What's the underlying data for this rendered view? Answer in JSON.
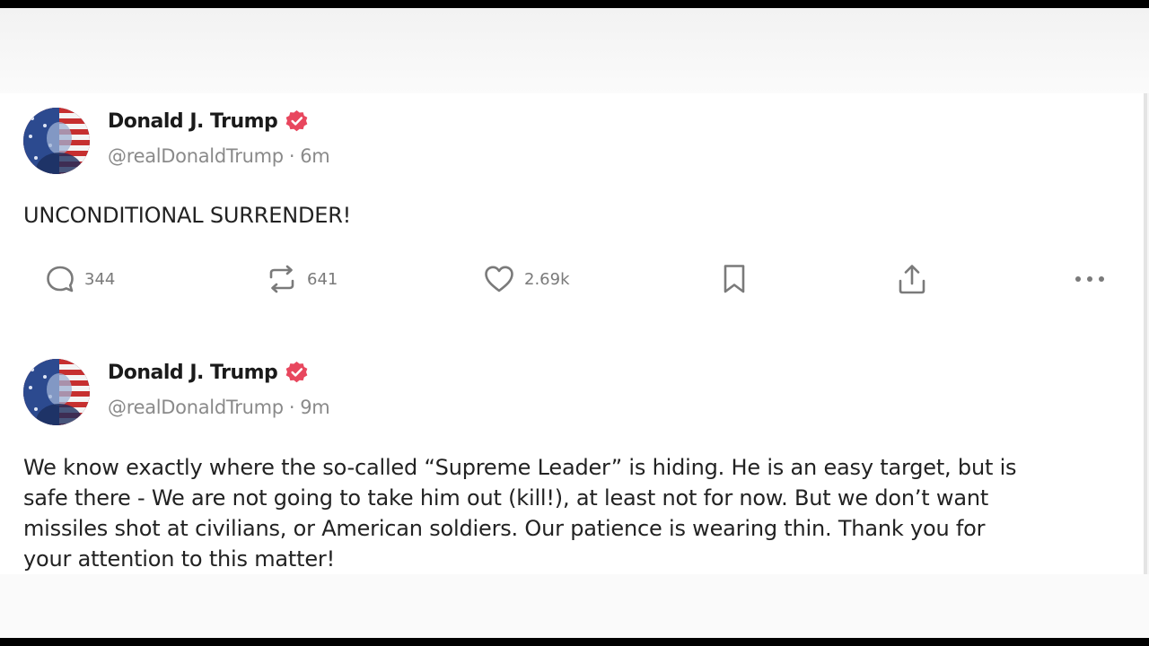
{
  "posts": [
    {
      "display_name": "Donald J. Trump",
      "handle": "@realDonaldTrump",
      "separator": "·",
      "time": "6m",
      "text": "UNCONDITIONAL SURRENDER!",
      "actions": {
        "replies": "344",
        "reposts": "641",
        "likes": "2.69k"
      }
    },
    {
      "display_name": "Donald J. Trump",
      "handle": "@realDonaldTrump",
      "separator": "·",
      "time": "9m",
      "text_lines": [
        "We know exactly where the so-called “Supreme Leader” is hiding. He is an easy target, but is",
        "safe there - We are not going to take him out (kill!), at least not for now. But we don’t want",
        "missiles shot at civilians, or American soldiers. Our patience is wearing thin. Thank you for",
        "your attention to this matter!"
      ]
    }
  ],
  "icons": {
    "verified": "verified-badge-icon",
    "reply": "reply-bubble-icon",
    "repost": "repost-arrows-icon",
    "like": "heart-icon",
    "bookmark": "bookmark-icon",
    "share": "share-upload-icon",
    "more": "more-dots-icon"
  },
  "colors": {
    "verified_badge": "#e8475e",
    "muted_text": "#8a8a8a",
    "icon_gray": "#7a7a7a"
  }
}
